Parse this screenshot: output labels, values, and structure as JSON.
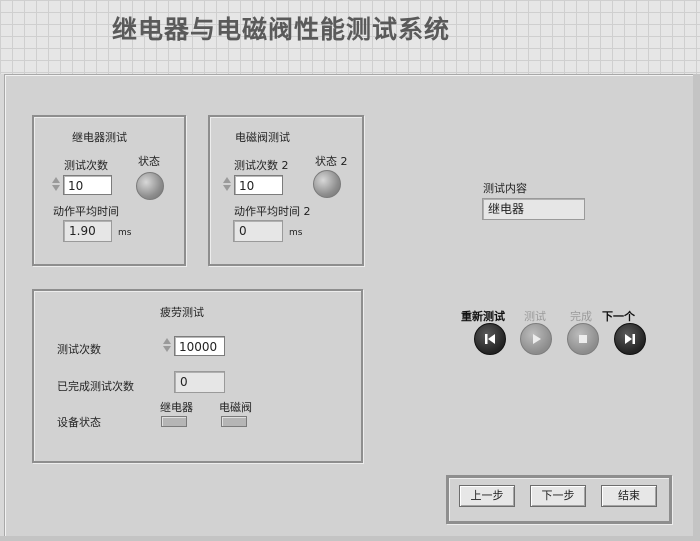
{
  "title": "继电器与电磁阀性能测试系统",
  "relay_test": {
    "group_label": "继电器测试",
    "count_label": "测试次数",
    "count_value": "10",
    "status_label": "状态",
    "avg_time_label": "动作平均时间",
    "avg_time_value": "1.90",
    "unit": "ms"
  },
  "valve_test": {
    "group_label": "电磁阀测试",
    "count_label": "测试次数 2",
    "count_value": "10",
    "status_label": "状态 2",
    "avg_time_label": "动作平均时间 2",
    "avg_time_value": "0",
    "unit": "ms"
  },
  "test_content": {
    "label": "测试内容",
    "value": "继电器"
  },
  "fatigue_test": {
    "group_label": "疲劳测试",
    "count_label": "测试次数",
    "count_value": "10000",
    "completed_label": "已完成测试次数",
    "completed_value": "0",
    "device_status_label": "设备状态",
    "relay_label": "继电器",
    "valve_label": "电磁阀"
  },
  "controls": {
    "restart_label": "重新测试",
    "test_label": "测试",
    "done_label": "完成",
    "next_one_label": "下一个"
  },
  "nav": {
    "prev_step": "上一步",
    "next_step": "下一步",
    "finish": "结束"
  },
  "colors": {
    "panel": "#d2d2d2",
    "grid_bg": "#e6e6e6"
  }
}
